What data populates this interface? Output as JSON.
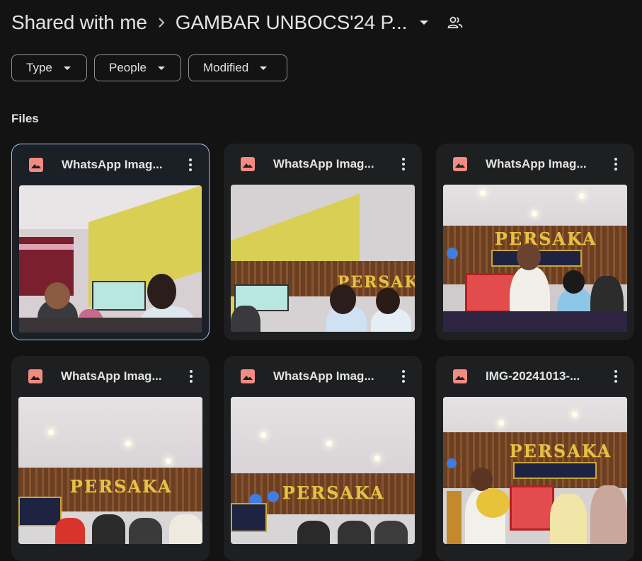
{
  "breadcrumb": {
    "root": "Shared with me",
    "current": "GAMBAR UNBOCS'24 P..."
  },
  "filters": [
    {
      "label": "Type"
    },
    {
      "label": "People"
    },
    {
      "label": "Modified"
    }
  ],
  "section": {
    "title": "Files"
  },
  "files": [
    {
      "name": "WhatsApp Imag...",
      "selected": true
    },
    {
      "name": "WhatsApp Imag...",
      "selected": false
    },
    {
      "name": "WhatsApp Imag...",
      "selected": false
    },
    {
      "name": "WhatsApp Imag...",
      "selected": false
    },
    {
      "name": "WhatsApp Imag...",
      "selected": false
    },
    {
      "name": "IMG-20241013-...",
      "selected": false
    }
  ],
  "thumb_text": {
    "persaka": "PERSAKA"
  },
  "colors": {
    "background": "#131314",
    "card": "#1e1f20",
    "selected_border": "#a8c7fa",
    "image_icon": "#f28b82",
    "text": "#e3e3e3"
  }
}
